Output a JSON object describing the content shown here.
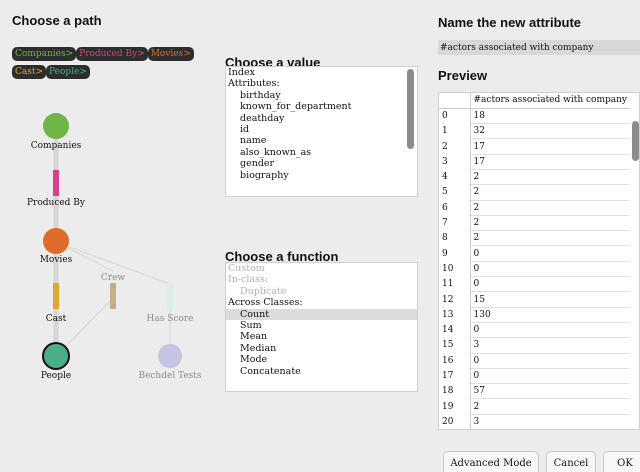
{
  "left": {
    "title": "Choose a path",
    "path_chips": [
      {
        "text": "Companies>",
        "color": "#6fb548"
      },
      {
        "text": "Produced By>",
        "color": "#d8408a"
      },
      {
        "text": "Movies>",
        "color": "#e06a2a"
      },
      {
        "text": "Cast>",
        "color": "#e0a830"
      },
      {
        "text": "People>",
        "color": "#4cae88"
      }
    ],
    "graph": {
      "companies": "Companies",
      "produced_by": "Produced By",
      "movies": "Movies",
      "crew": "Crew",
      "cast": "Cast",
      "has_score": "Has Score",
      "people": "People",
      "bechdel_tests": "Bechdel Tests"
    }
  },
  "value": {
    "title": "Choose a value",
    "items": [
      {
        "text": "Index",
        "indent": false
      },
      {
        "text": "Attributes:",
        "indent": false
      },
      {
        "text": "birthday",
        "indent": true
      },
      {
        "text": "known_for_department",
        "indent": true
      },
      {
        "text": "deathday",
        "indent": true
      },
      {
        "text": "id",
        "indent": true
      },
      {
        "text": "name",
        "indent": true
      },
      {
        "text": "also_known_as",
        "indent": true
      },
      {
        "text": "gender",
        "indent": true
      },
      {
        "text": "biography",
        "indent": true
      }
    ]
  },
  "function": {
    "title": "Choose a function",
    "items": [
      {
        "text": "Custom",
        "indent": false,
        "disabled": true
      },
      {
        "text": "In-class:",
        "indent": false,
        "disabled": true
      },
      {
        "text": "Duplicate",
        "indent": true,
        "disabled": true
      },
      {
        "text": "Across Classes:",
        "indent": false,
        "disabled": false
      },
      {
        "text": "Count",
        "indent": true,
        "disabled": false,
        "selected": true
      },
      {
        "text": "Sum",
        "indent": true,
        "disabled": false
      },
      {
        "text": "Mean",
        "indent": true,
        "disabled": false
      },
      {
        "text": "Median",
        "indent": true,
        "disabled": false
      },
      {
        "text": "Mode",
        "indent": true,
        "disabled": false
      },
      {
        "text": "Concatenate",
        "indent": true,
        "disabled": false
      }
    ]
  },
  "attribute": {
    "title": "Name the new attribute",
    "value": "#actors associated with company"
  },
  "preview": {
    "title": "Preview",
    "column": "#actors associated with company",
    "rows": [
      [
        "0",
        "18"
      ],
      [
        "1",
        "32"
      ],
      [
        "2",
        "17"
      ],
      [
        "3",
        "17"
      ],
      [
        "4",
        "2"
      ],
      [
        "5",
        "2"
      ],
      [
        "6",
        "2"
      ],
      [
        "7",
        "2"
      ],
      [
        "8",
        "2"
      ],
      [
        "9",
        "0"
      ],
      [
        "10",
        "0"
      ],
      [
        "11",
        "0"
      ],
      [
        "12",
        "15"
      ],
      [
        "13",
        "130"
      ],
      [
        "14",
        "0"
      ],
      [
        "15",
        "3"
      ],
      [
        "16",
        "0"
      ],
      [
        "17",
        "0"
      ],
      [
        "18",
        "57"
      ],
      [
        "19",
        "2"
      ],
      [
        "20",
        "3"
      ]
    ]
  },
  "buttons": {
    "advanced": "Advanced Mode",
    "cancel": "Cancel",
    "ok": "OK"
  }
}
